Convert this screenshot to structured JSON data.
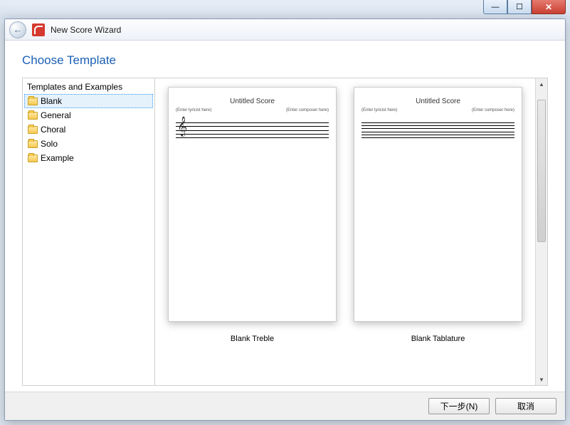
{
  "window": {
    "title": "New Score Wizard"
  },
  "win_controls": {
    "min": "—",
    "max": "☐",
    "close": "✕"
  },
  "page": {
    "title": "Choose Template"
  },
  "tree": {
    "header": "Templates and Examples",
    "items": [
      {
        "label": "Blank",
        "selected": true
      },
      {
        "label": "General",
        "selected": false
      },
      {
        "label": "Choral",
        "selected": false
      },
      {
        "label": "Solo",
        "selected": false
      },
      {
        "label": "Example",
        "selected": false
      }
    ]
  },
  "templates": [
    {
      "label": "Blank Treble",
      "preview": {
        "title": "Untitled Score",
        "lyricist": "(Enter lyricist here)",
        "composer": "(Enter composer here)",
        "staff": "treble"
      }
    },
    {
      "label": "Blank Tablature",
      "preview": {
        "title": "Untitled Score",
        "lyricist": "(Enter lyricist here)",
        "composer": "(Enter composer here)",
        "staff": "tab"
      }
    }
  ],
  "footer": {
    "next": "下一步(N)",
    "cancel": "取消"
  }
}
